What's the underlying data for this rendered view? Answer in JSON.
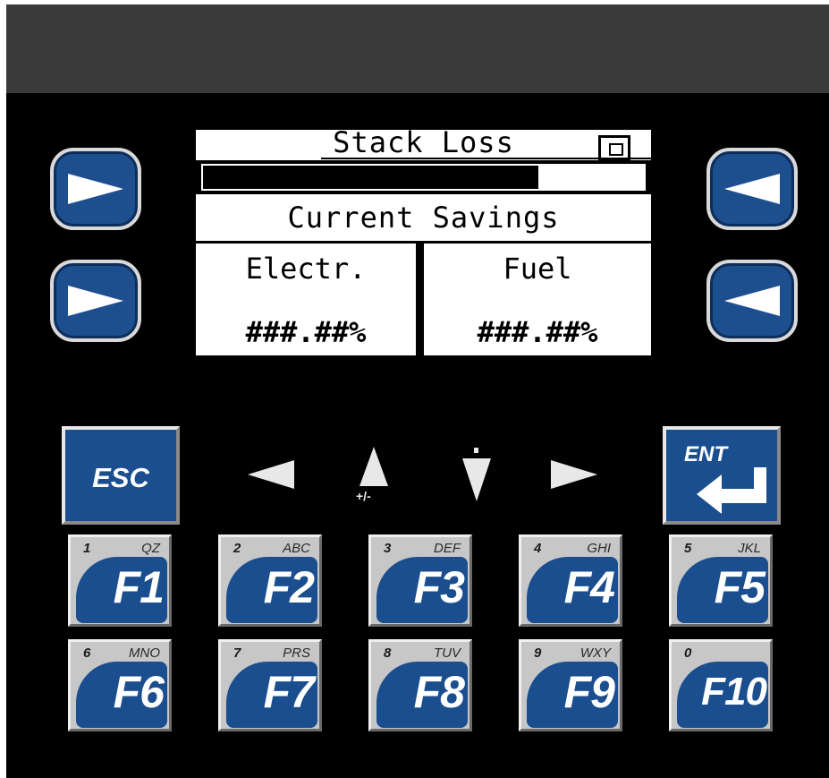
{
  "lcd": {
    "title": "Stack Loss",
    "bar_level": 0.76,
    "subtitle": "Current Savings",
    "columns": [
      {
        "label": "Electr.",
        "value": "###.##%"
      },
      {
        "label": "Fuel",
        "value": "###.##%"
      }
    ]
  },
  "keys": {
    "esc": "ESC",
    "ent": "ENT",
    "plusminus": "+/-",
    "function_keys": [
      {
        "num": "1",
        "letters": "QZ",
        "label": "F1"
      },
      {
        "num": "2",
        "letters": "ABC",
        "label": "F2"
      },
      {
        "num": "3",
        "letters": "DEF",
        "label": "F3"
      },
      {
        "num": "4",
        "letters": "GHI",
        "label": "F4"
      },
      {
        "num": "5",
        "letters": "JKL",
        "label": "F5"
      },
      {
        "num": "6",
        "letters": "MNO",
        "label": "F6"
      },
      {
        "num": "7",
        "letters": "PRS",
        "label": "F7"
      },
      {
        "num": "8",
        "letters": "TUV",
        "label": "F8"
      },
      {
        "num": "9",
        "letters": "WXY",
        "label": "F9"
      },
      {
        "num": "0",
        "letters": "",
        "label": "F10"
      }
    ]
  },
  "icons": {
    "left_softkeys": "arrow-right-icon",
    "right_softkeys": "arrow-left-icon",
    "nav": [
      "arrow-left-icon",
      "arrow-up-icon",
      "arrow-down-icon",
      "arrow-right-icon"
    ],
    "enter": "enter-return-icon"
  },
  "colors": {
    "key_blue": "#1a4e8e",
    "lcd_background": "#ffffff",
    "panel": "#000000",
    "header": "#3a3a3a"
  }
}
